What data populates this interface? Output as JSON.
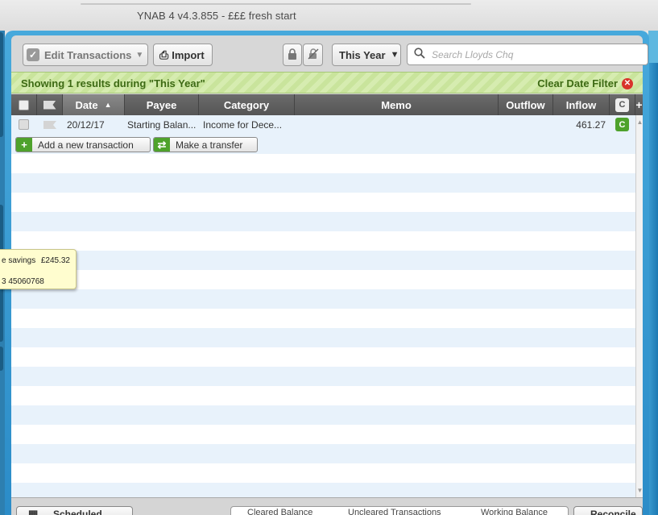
{
  "window": {
    "title": "YNAB 4 v4.3.855 - £££ fresh start"
  },
  "toolbar": {
    "edit_label": "Edit Transactions",
    "import_label": "Import",
    "date_range_label": "This Year",
    "search_placeholder": "Search Lloyds Chq"
  },
  "filter": {
    "message": "Showing 1 results during \"This Year\"",
    "clear_label": "Clear Date Filter"
  },
  "table": {
    "columns": {
      "date": "Date",
      "payee": "Payee",
      "category": "Category",
      "memo": "Memo",
      "outflow": "Outflow",
      "inflow": "Inflow",
      "cleared": "C",
      "add": "+"
    },
    "rows": [
      {
        "date": "20/12/17",
        "payee": "Starting Balan...",
        "category": "Income for Dece...",
        "memo": "",
        "outflow": "",
        "inflow": "461.27",
        "cleared": "C"
      }
    ]
  },
  "actions": {
    "add_transaction": "Add a new transaction",
    "make_transfer": "Make a transfer"
  },
  "tooltip": {
    "line1_label": "e savings",
    "line1_value": "£245.32",
    "line2_label": "3 45060768"
  },
  "footer": {
    "scheduled_label": "Scheduled",
    "cleared_balance": "Cleared Balance",
    "uncleared_transactions": "Uncleared Transactions",
    "working_balance": "Working Balance",
    "reconcile_label": "Reconcile"
  },
  "colors": {
    "accent_blue": "#2b8cc8",
    "filter_green": "#3d6a14",
    "cleared_green": "#4ea22c",
    "clear_red": "#d8342b"
  }
}
